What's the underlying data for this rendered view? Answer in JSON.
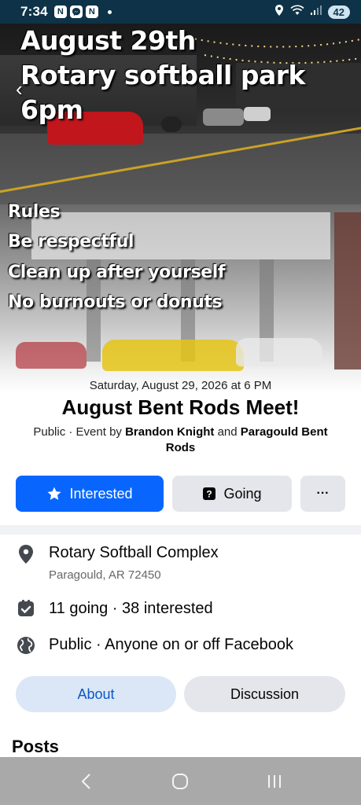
{
  "status_bar": {
    "time": "7:34",
    "app_icons": [
      "N",
      "messenger-icon",
      "N"
    ],
    "battery": "42"
  },
  "cover": {
    "line1": "August 29th",
    "line2": "Rotary softball park",
    "line3": "6pm",
    "rules_heading": "Rules",
    "rule1": "Be respectful",
    "rule2": "Clean up after yourself",
    "rule3": "No burnouts or donuts"
  },
  "event": {
    "date_time": "Saturday, August 29, 2026 at 6 PM",
    "title": "August Bent Rods Meet!",
    "privacy_prefix": "Public · Event by ",
    "host1": "Brandon Knight",
    "and": " and ",
    "host2": "Paragould Bent Rods"
  },
  "actions": {
    "interested_label": "Interested",
    "going_label": "Going",
    "more_label": "···"
  },
  "details": {
    "location_name": "Rotary Softball Complex",
    "location_address": "Paragould, AR 72450",
    "attendance": "11 going · 38 interested",
    "privacy": "Public · Anyone on or off Facebook"
  },
  "tabs": {
    "about": "About",
    "discussion": "Discussion"
  },
  "posts_heading": "Posts",
  "colors": {
    "primary_blue": "#0866ff",
    "status_bar": "#0e3348",
    "nav_bar": "#a9a9a9"
  }
}
